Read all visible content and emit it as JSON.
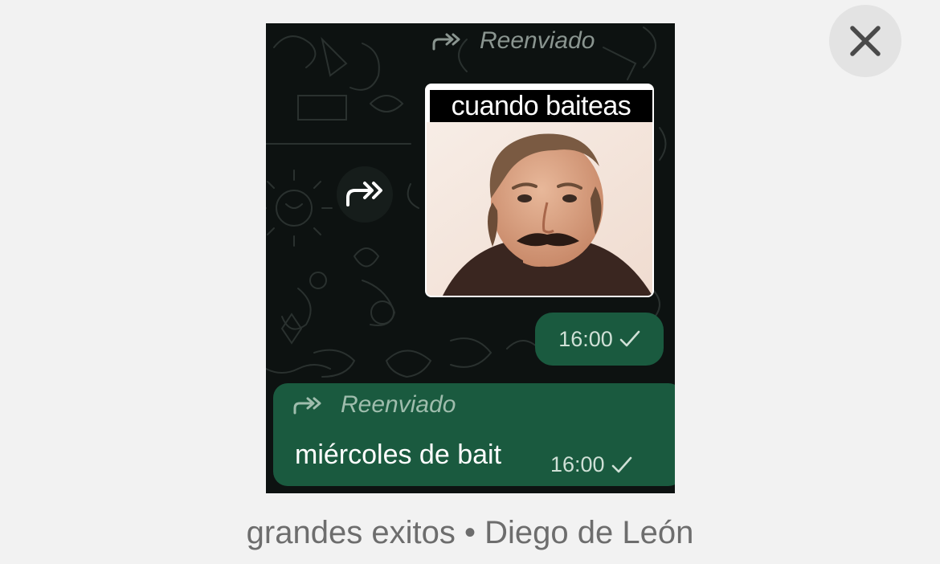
{
  "close_button": {
    "icon": "close-icon"
  },
  "chat": {
    "top_forwarded_label": "Reenviado",
    "sticker_caption": "cuando baiteas",
    "sticker_time": "16:00",
    "message": {
      "forwarded_label": "Reenviado",
      "text": "miércoles de bait",
      "time": "16:00"
    }
  },
  "caption": {
    "album": "grandes exitos",
    "separator": "•",
    "author": "Diego de León"
  },
  "colors": {
    "background": "#f2f2f2",
    "chat_background": "#0d1211",
    "bubble_green": "#1a5a3f",
    "caption_gray": "#6d6d6d"
  }
}
